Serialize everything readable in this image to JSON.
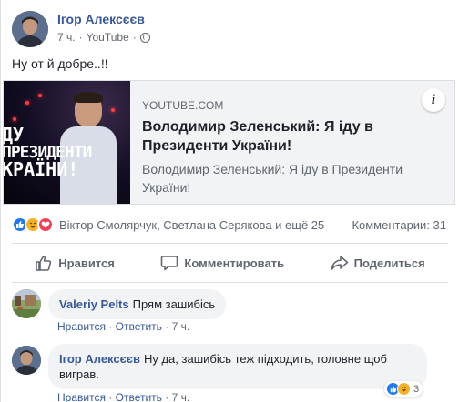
{
  "post": {
    "author": "Ігор Алексєєв",
    "time": "7 ч.",
    "source": "YouTube",
    "text": "Ну от й добре..!!"
  },
  "link_preview": {
    "thumbnail_text": [
      "ДУ",
      "ПРЕЗИДЕНТИ",
      "КРАЇНИ!"
    ],
    "domain": "YOUTUBE.COM",
    "title": "Володимир Зеленський: Я іду в Президенти України!",
    "description": "Володимир Зеленський: Я іду в Президенти України!",
    "info_icon": "i"
  },
  "reactions": {
    "icons": [
      "like-icon",
      "haha-icon",
      "love-icon"
    ],
    "names": "Віктор Смолярчук, Светлана Серякова и ещё 25",
    "comments_count": "Комментарии: 31"
  },
  "actions": {
    "like": "Нравится",
    "comment": "Комментировать",
    "share": "Поделиться"
  },
  "comments": [
    {
      "author": "Valeriy Pelts",
      "text": "Прям зашибісь",
      "like": "Нравится",
      "reply": "Ответить",
      "time": "7 ч."
    },
    {
      "author": "Ігор Алексєєв",
      "text": "Ну да, зашибісь теж підходить, головне щоб виграв.",
      "like": "Нравится",
      "reply": "Ответить",
      "time": "7 ч.",
      "reaction_count": "3"
    }
  ],
  "colors": {
    "link_blue": "#385898",
    "meta_gray": "#616770",
    "like_blue": "#2078f4",
    "love_red": "#f33e58",
    "haha_yellow": "#f7b125"
  }
}
